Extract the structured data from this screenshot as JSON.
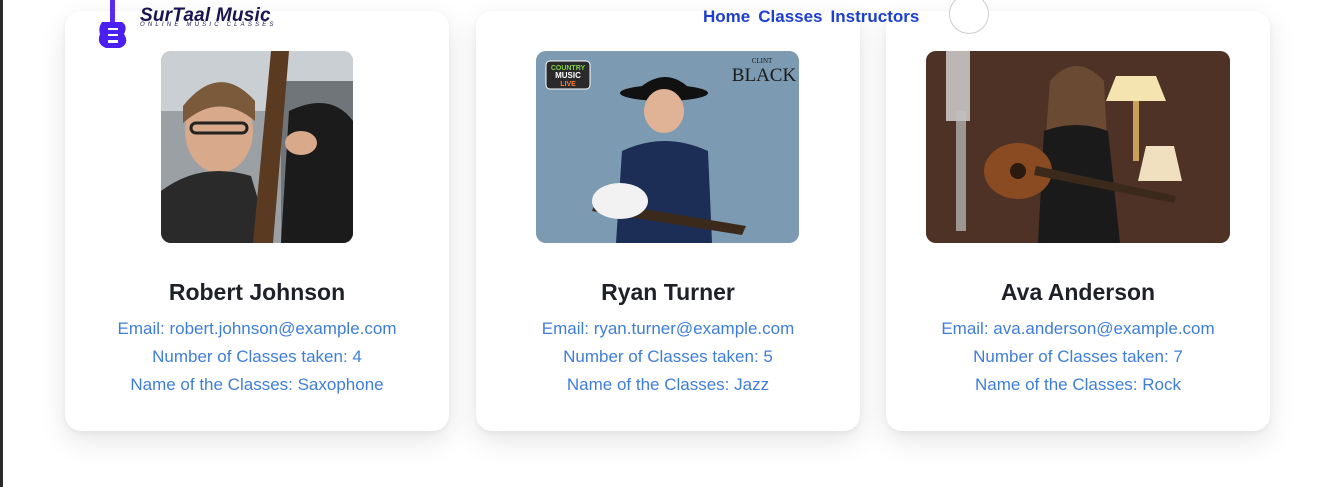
{
  "header": {
    "brand_title": "SurTaal Music",
    "brand_subtitle": "ONLINE MUSIC CLASSES",
    "nav": [
      "Home",
      "Classes",
      "Instructors"
    ],
    "brand_color": "#1a1550",
    "nav_color": "#1d3fd0"
  },
  "instructors": [
    {
      "name": "Robert Johnson",
      "email": "Email: robert.johnson@example.com",
      "classes_taken": "Number of Classes taken: 4",
      "class_names": "Name of the Classes: Saxophone",
      "photo_icon": "upright-bass-player-photo"
    },
    {
      "name": "Ryan Turner",
      "email": "Email: ryan.turner@example.com",
      "classes_taken": "Number of Classes taken: 5",
      "class_names": "Name of the Classes: Jazz",
      "photo_icon": "country-guitarist-photo",
      "photo_text": {
        "badge_line1": "COUNTRY",
        "badge_line2": "MUSIC",
        "badge_line3": "LIVE",
        "corner_line1": "CLINT",
        "corner_line2": "BLACK"
      }
    },
    {
      "name": "Ava Anderson",
      "email": "Email: ava.anderson@example.com",
      "classes_taken": "Number of Classes taken: 7",
      "class_names": "Name of the Classes: Rock",
      "photo_icon": "acoustic-guitarist-photo"
    }
  ],
  "colors": {
    "link_text": "#3f7ed8",
    "name_text": "#1e2127"
  }
}
